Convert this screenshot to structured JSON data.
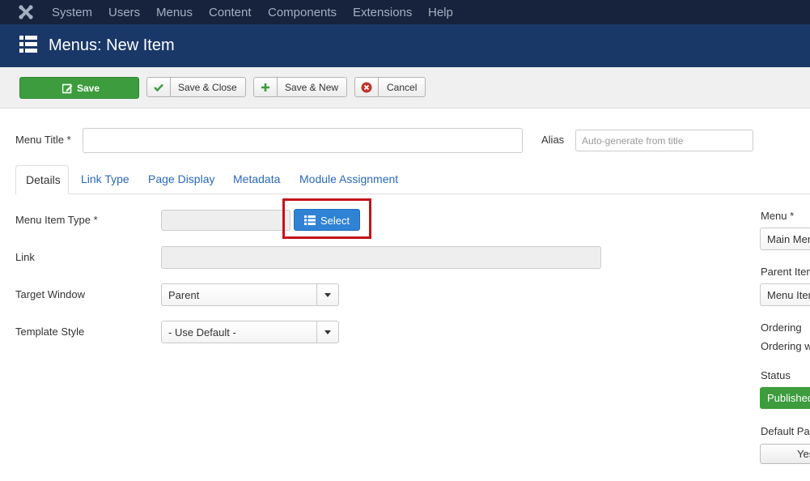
{
  "topnav": {
    "items": [
      "System",
      "Users",
      "Menus",
      "Content",
      "Components",
      "Extensions",
      "Help"
    ]
  },
  "header": {
    "title": "Menus: New Item"
  },
  "toolbar": {
    "save": "Save",
    "save_close": "Save & Close",
    "save_new": "Save & New",
    "cancel": "Cancel"
  },
  "form": {
    "menu_title_label": "Menu Title *",
    "menu_title_value": "",
    "alias_label": "Alias",
    "alias_placeholder": "Auto-generate from title"
  },
  "tabs": [
    "Details",
    "Link Type",
    "Page Display",
    "Metadata",
    "Module Assignment"
  ],
  "details": {
    "menu_item_type_label": "Menu Item Type *",
    "select_button": "Select",
    "link_label": "Link",
    "target_window_label": "Target Window",
    "target_window_value": "Parent",
    "template_style_label": "Template Style",
    "template_style_value": "- Use Default -"
  },
  "sidebar": {
    "menu_label": "Menu *",
    "menu_value": "Main Men",
    "parent_label": "Parent Item",
    "parent_value": "Menu Item",
    "ordering_label": "Ordering",
    "ordering_value": "Ordering w",
    "status_label": "Status",
    "status_value": "Published",
    "default_page_label": "Default Pa",
    "default_page_value": "Yes"
  },
  "colors": {
    "topnav_bg": "#17233c",
    "header_bg": "#1a3867",
    "save_green": "#3d9c3d",
    "select_blue": "#2f82d4",
    "highlight_red": "#c4141b"
  }
}
